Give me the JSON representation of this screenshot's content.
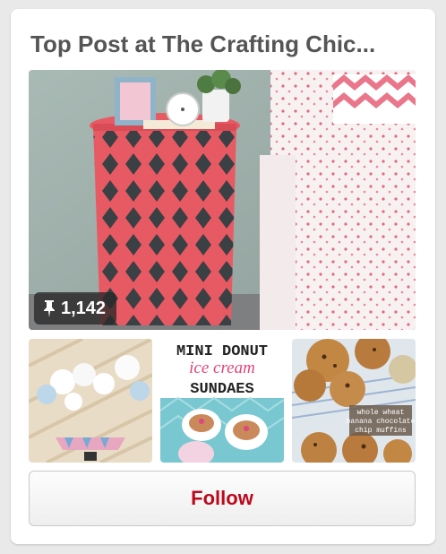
{
  "widget": {
    "title": "Top Post at The Crafting Chic...",
    "main_pin": {
      "repin_count": "1,142",
      "pin_icon": "pushpin-icon"
    },
    "thumbnails": [
      {
        "caption_top": "MINI DONUT",
        "caption_mid": "ice cream",
        "caption_bottom": "SUNDAES"
      },
      {
        "caption_lines": [
          "whole wheat",
          "banana chocolate",
          "chip muffins"
        ]
      }
    ],
    "follow_label": "Follow"
  },
  "colors": {
    "accent": "#bd081c",
    "title": "#555555"
  }
}
